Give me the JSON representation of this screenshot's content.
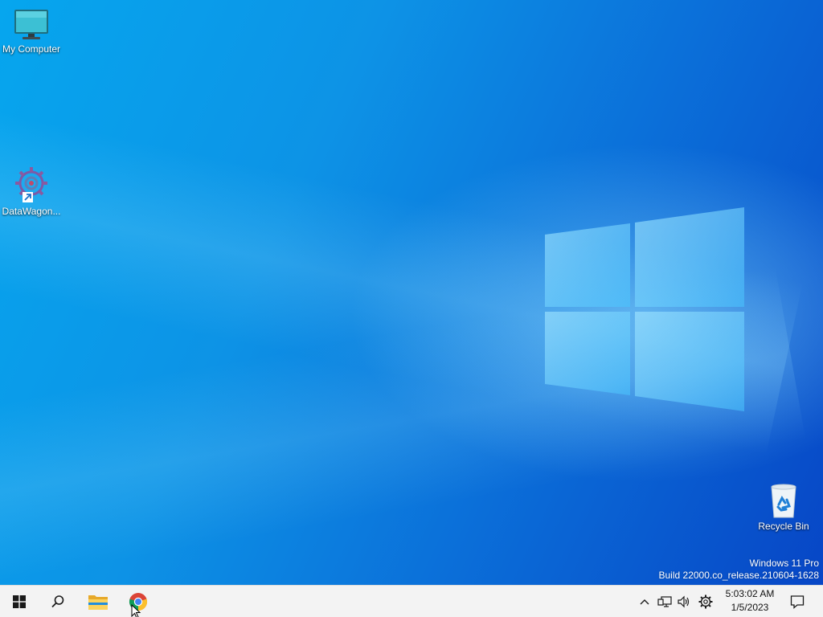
{
  "desktop": {
    "icons": [
      {
        "label": "My Computer",
        "icon": "computer-monitor-icon"
      },
      {
        "label": "DataWagon...",
        "icon": "datawagon-gear-icon"
      },
      {
        "label": "Recycle Bin",
        "icon": "recycle-bin-icon"
      }
    ],
    "watermark": {
      "line1": "Windows 11 Pro",
      "line2": "Build 22000.co_release.210604-1628"
    }
  },
  "taskbar": {
    "start_icon": "windows-start-icon",
    "search_icon": "search-icon",
    "pinned": [
      {
        "name": "File Explorer",
        "icon": "file-explorer-icon"
      },
      {
        "name": "Google Chrome",
        "icon": "chrome-icon"
      }
    ],
    "tray": {
      "icons": [
        "chevron-up-icon",
        "network-icon",
        "volume-icon",
        "settings-gear-icon"
      ],
      "time": "5:03:02 AM",
      "date": "1/5/2023",
      "notifications_icon": "notification-icon"
    }
  },
  "colors": {
    "wallpaper_light": "#06a6ee",
    "wallpaper_dark": "#0746c6",
    "taskbar": "#f3f3f3"
  }
}
